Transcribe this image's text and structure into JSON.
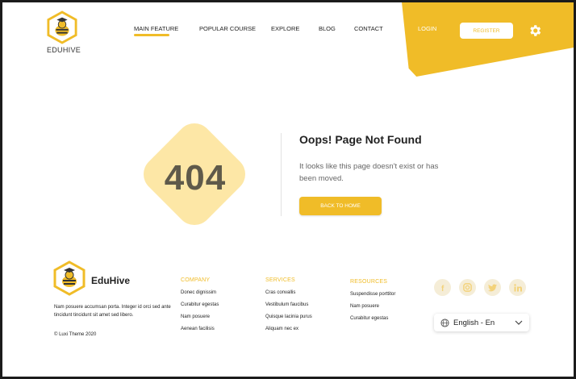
{
  "header": {
    "brand": "EDUHIVE",
    "nav": [
      {
        "label": "MAIN FEATURE",
        "active": true
      },
      {
        "label": "POPULAR COURSE",
        "active": false
      },
      {
        "label": "EXPLORE",
        "active": false
      },
      {
        "label": "BLOG",
        "active": false
      },
      {
        "label": "CONTACT",
        "active": false
      }
    ],
    "login_label": "LOGIN",
    "register_label": "REGISTER",
    "settings_icon": "gear-icon"
  },
  "error": {
    "code": "404",
    "title": "Oops! Page Not Found",
    "message": "It looks like this page doesn't exist or has been moved.",
    "button_label": "BACK TO HOME"
  },
  "footer": {
    "brand": "EduHive",
    "description": "Nam posuere accumsan porta. Integer id orci sed ante tincidunt tincidunt sit amet sed libero.",
    "copyright": "© Luxi Theme 2020",
    "columns": [
      {
        "title": "COMPANY",
        "links": [
          "Donec dignissim",
          "Curabitur egestas",
          "Nam posuere",
          "Aenean facilisis"
        ]
      },
      {
        "title": "SERVICES",
        "links": [
          "Cras convallis",
          "Vestibulum faucibus",
          "Quisque lacinia purus",
          "Aliquam nec ex"
        ]
      },
      {
        "title": "RESOURCES",
        "links": [
          "Suspendisse porttitor",
          "Nam posuere",
          "Curabitur egestas"
        ]
      }
    ],
    "social_icons": [
      "facebook-icon",
      "instagram-icon",
      "twitter-icon",
      "linkedin-icon"
    ],
    "language": "English - En"
  },
  "colors": {
    "accent": "#f0bc28",
    "accent_light": "#fde7a6",
    "text": "#222222"
  }
}
